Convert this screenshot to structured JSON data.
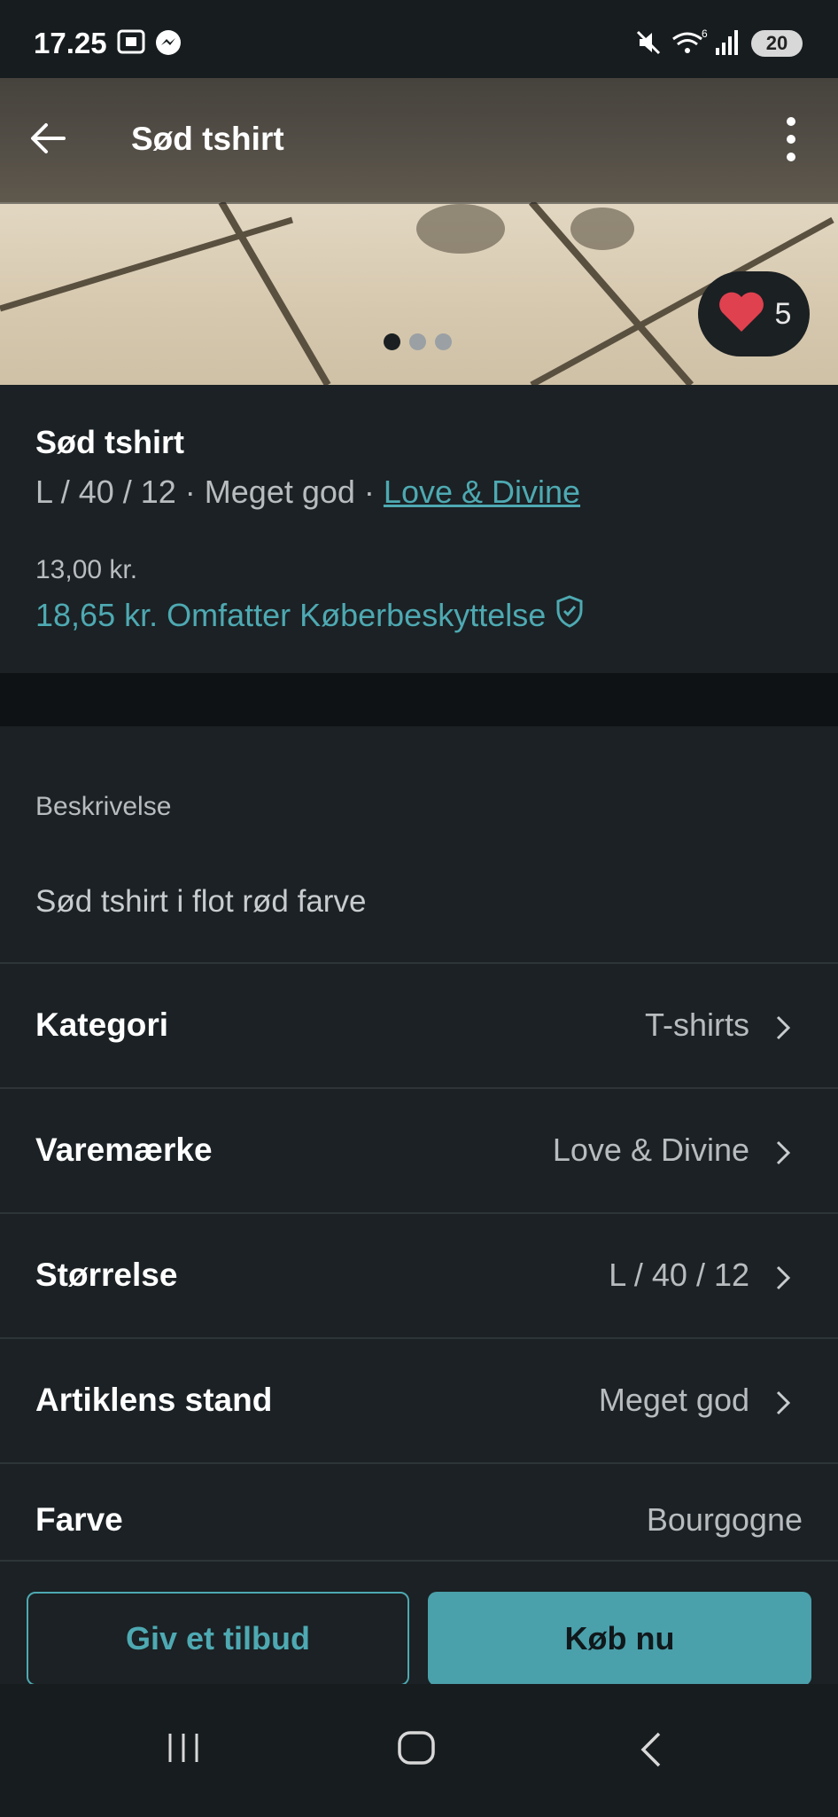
{
  "status_bar": {
    "time": "17.25",
    "battery": "20"
  },
  "header": {
    "title": "Sød tshirt"
  },
  "gallery": {
    "favorites_count": "5",
    "dots": 3,
    "active_dot": 0
  },
  "product": {
    "title": "Sød tshirt",
    "size": "L / 40 / 12",
    "separator": " · ",
    "condition": "Meget god",
    "brand": "Love & Divine",
    "price": "13,00 kr.",
    "total_price": "18,65 kr.",
    "protection_label": "Omfatter Køberbeskyttelse"
  },
  "description": {
    "label": "Beskrivelse",
    "text": "Sød tshirt i flot rød farve"
  },
  "details": [
    {
      "label": "Kategori",
      "value": "T-shirts"
    },
    {
      "label": "Varemærke",
      "value": "Love & Divine"
    },
    {
      "label": "Størrelse",
      "value": "L / 40 / 12"
    },
    {
      "label": "Artiklens stand",
      "value": "Meget god"
    },
    {
      "label": "Farve",
      "value": "Bourgogne"
    }
  ],
  "actions": {
    "offer_label": "Giv et tilbud",
    "buy_label": "Køb nu"
  },
  "colors": {
    "accent": "#4ea9b2",
    "background": "#1b2124",
    "heart": "#e0414f"
  }
}
